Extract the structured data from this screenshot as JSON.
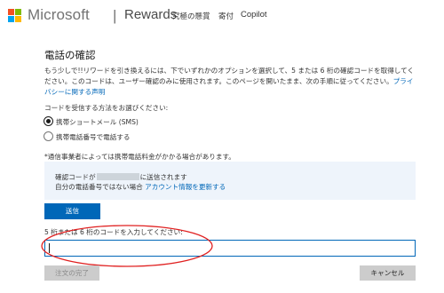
{
  "header": {
    "brand": "Microsoft",
    "separator": "|",
    "product": "Rewards",
    "nav": [
      "究極の懸賞",
      "寄付",
      "Copilot"
    ]
  },
  "main": {
    "title": "電話の確認",
    "description": "もう少しで!!リワードを引き換えるには、下でいずれかのオプションを選択して、5 または 6 桁の確認コードを取得してください。このコードは、ユーザー確認のみに使用されます。このページを開いたまま、次の手順に従ってください。",
    "privacy_link": "プライバシーに関する声明",
    "method_prompt": "コードを受信する方法をお選びください:",
    "options": [
      {
        "label": "携帯ショートメール (SMS)",
        "selected": true
      },
      {
        "label": "携帯電話番号で電話する",
        "selected": false
      }
    ],
    "carrier_note": "*通信事業者によっては携帯電話料金がかかる場合があります。",
    "info": {
      "sent_prefix": "確認コードが",
      "sent_suffix": "に送信されます",
      "not_your_number": "自分の電話番号ではない場合",
      "update_link": "アカウント情報を更新する"
    },
    "send_button": "送信",
    "code_label": "5 桁または 6 桁のコードを入力してください:",
    "code_value": "",
    "verify_button": "注文の完了",
    "cancel_button": "キャンセル"
  },
  "colors": {
    "accent": "#0067b8",
    "annotation": "#e02020",
    "info_bg": "#eef4fb",
    "button_disabled": "#cccccc"
  }
}
